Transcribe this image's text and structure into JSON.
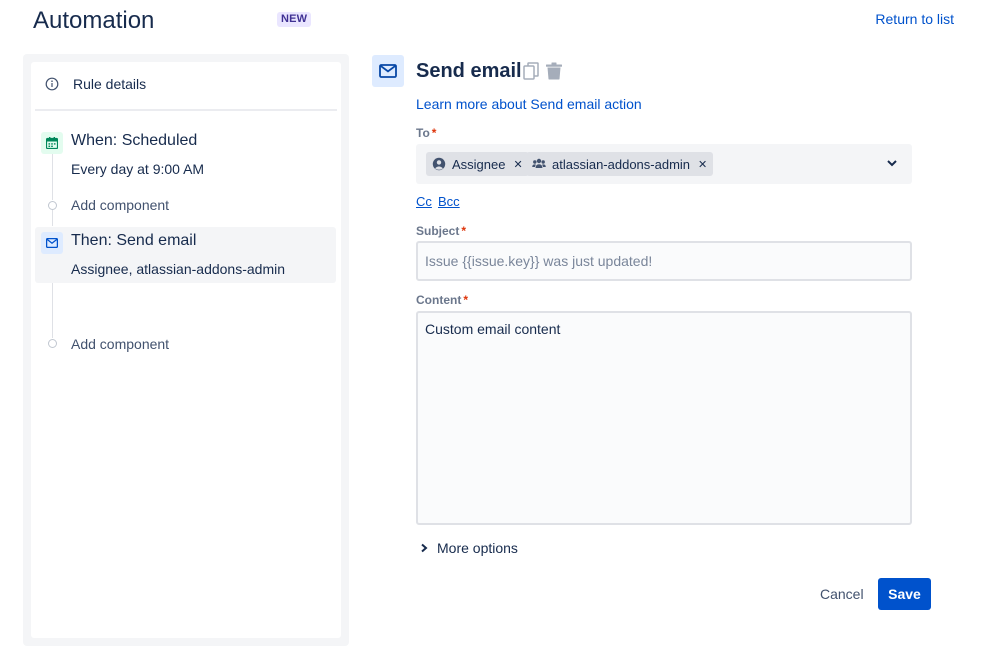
{
  "header": {
    "title": "Automation",
    "badge": "NEW",
    "return_link": "Return to list"
  },
  "sidebar": {
    "rule_details": "Rule details",
    "trigger": {
      "title": "When: Scheduled",
      "subtitle": "Every day at 9:00 AM",
      "icon": "calendar-icon"
    },
    "add_component_1": "Add component",
    "action": {
      "title": "Then: Send email",
      "subtitle": "Assignee, atlassian-addons-admin",
      "icon": "mail-icon"
    },
    "add_component_2": "Add component"
  },
  "panel": {
    "title": "Send email",
    "learn_more": "Learn more about Send email action",
    "to": {
      "label": "To",
      "recipients": [
        {
          "label": "Assignee",
          "icon": "user-circle-icon"
        },
        {
          "label": "atlassian-addons-admin",
          "icon": "group-icon"
        }
      ]
    },
    "cc_label": "Cc",
    "bcc_label": "Bcc",
    "subject": {
      "label": "Subject",
      "placeholder": "Issue {{issue.key}} was just updated!",
      "value": ""
    },
    "content": {
      "label": "Content",
      "value": "Custom email content"
    },
    "more_options": "More options",
    "cancel_label": "Cancel",
    "save_label": "Save"
  },
  "colors": {
    "primary": "#0052cc",
    "text": "#172b4d",
    "badge_bg": "#eae6ff",
    "badge_text": "#403294",
    "trigger_icon_bg": "#e3fcef",
    "trigger_icon": "#00875a",
    "action_icon_bg": "#deebff",
    "required": "#de350b"
  }
}
